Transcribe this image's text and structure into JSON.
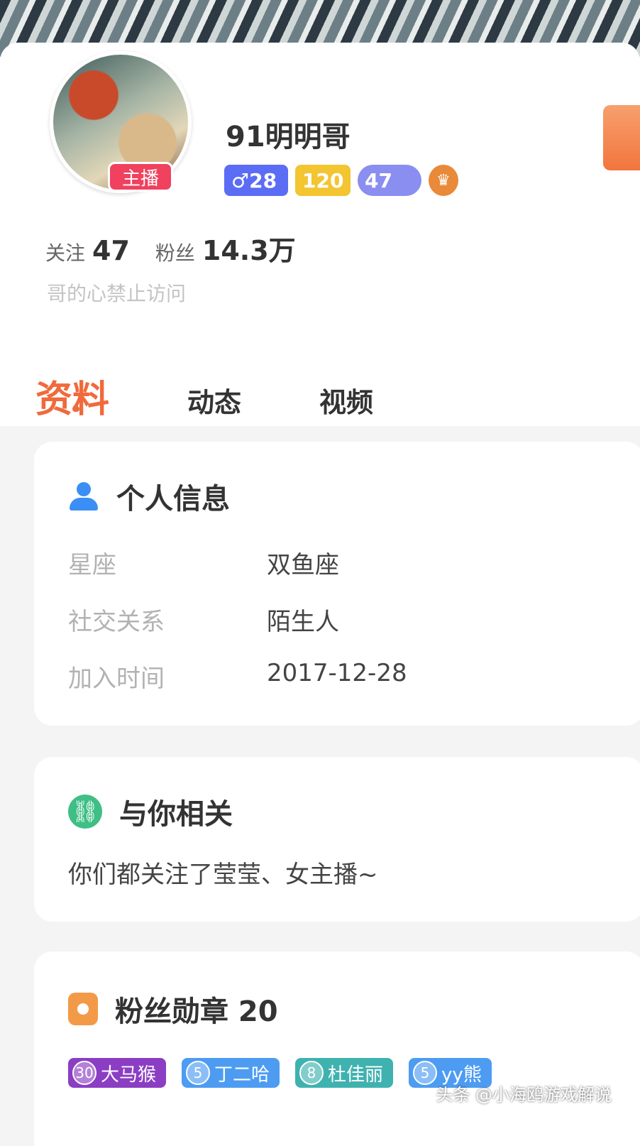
{
  "profile": {
    "username": "91明明哥",
    "host_badge": "主播",
    "badges": {
      "gender_age": "♂28",
      "wealth_level": "120",
      "fan_level": "47",
      "crown": "♛"
    },
    "following_label": "关注",
    "following_count": "47",
    "fans_label": "粉丝",
    "fans_count": "14.3万",
    "signature": "哥的心禁止访问"
  },
  "tabs": [
    {
      "label": "资料",
      "active": true
    },
    {
      "label": "动态",
      "active": false
    },
    {
      "label": "视频",
      "active": false
    }
  ],
  "personal_info": {
    "title": "个人信息",
    "rows": [
      {
        "label": "星座",
        "value": "双鱼座"
      },
      {
        "label": "社交关系",
        "value": "陌生人"
      },
      {
        "label": "加入时间",
        "value": "2017-12-28"
      }
    ]
  },
  "related": {
    "title": "与你相关",
    "text": "你们都关注了莹莹、女主播~"
  },
  "fan_medals": {
    "title": "粉丝勋章 20",
    "medals": [
      {
        "level": "30",
        "name": "大马猴",
        "color": "#8b3ec4"
      },
      {
        "level": "5",
        "name": "丁二哈",
        "color": "#4d9cf2"
      },
      {
        "level": "8",
        "name": "杜佳丽",
        "color": "#3fb2b0"
      },
      {
        "level": "5",
        "name": "yy熊",
        "color": "#4d9cf2"
      }
    ]
  },
  "watermark": "头条 @小海鸥游戏解说",
  "colors": {
    "accent": "#f06a3c",
    "host_badge": "#f0415f"
  }
}
